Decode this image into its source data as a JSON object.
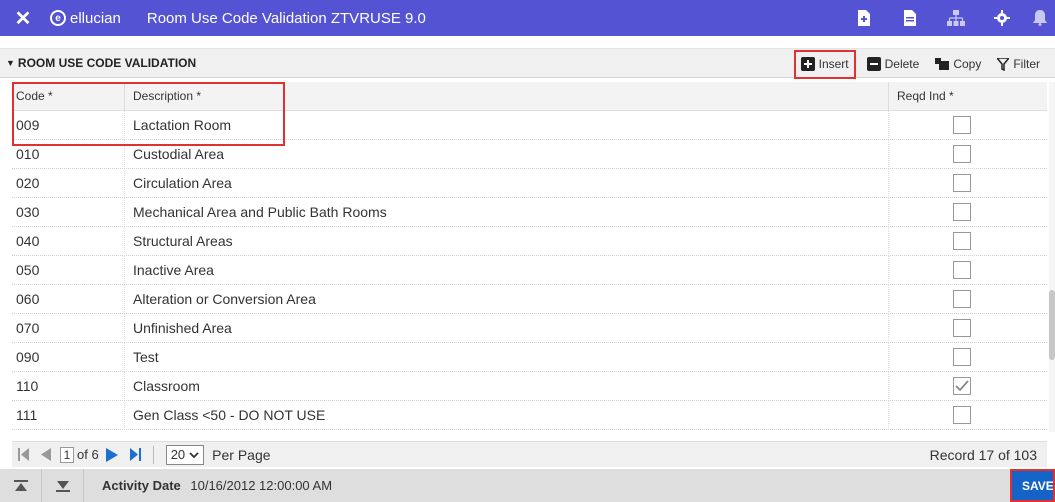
{
  "header": {
    "brand": "ellucian",
    "title": "Room Use Code Validation ZTVRUSE 9.0"
  },
  "section": {
    "title": "ROOM USE CODE VALIDATION",
    "actions": {
      "insert": "Insert",
      "delete": "Delete",
      "copy": "Copy",
      "filter": "Filter"
    }
  },
  "grid": {
    "columns": [
      "Code *",
      "Description *",
      "Reqd Ind *"
    ],
    "rows": [
      {
        "code": "009",
        "description": "Lactation Room",
        "reqd": false
      },
      {
        "code": "010",
        "description": "Custodial Area",
        "reqd": false
      },
      {
        "code": "020",
        "description": "Circulation Area",
        "reqd": false
      },
      {
        "code": "030",
        "description": "Mechanical Area and Public Bath Rooms",
        "reqd": false
      },
      {
        "code": "040",
        "description": "Structural Areas",
        "reqd": false
      },
      {
        "code": "050",
        "description": "Inactive Area",
        "reqd": false
      },
      {
        "code": "060",
        "description": "Alteration or Conversion Area",
        "reqd": false
      },
      {
        "code": "070",
        "description": "Unfinished Area",
        "reqd": false
      },
      {
        "code": "090",
        "description": "Test",
        "reqd": false
      },
      {
        "code": "110",
        "description": "Classroom",
        "reqd": true
      },
      {
        "code": "111",
        "description": "Gen Class <50 - DO NOT USE",
        "reqd": false
      }
    ]
  },
  "pager": {
    "page": "1",
    "of_pages": "of 6",
    "per_page": "20",
    "per_page_label": "Per Page",
    "record": "Record 17 of 103"
  },
  "footer": {
    "activity_label": "Activity Date",
    "activity_value": "10/16/2012 12:00:00 AM",
    "save_label": "SAVE"
  }
}
